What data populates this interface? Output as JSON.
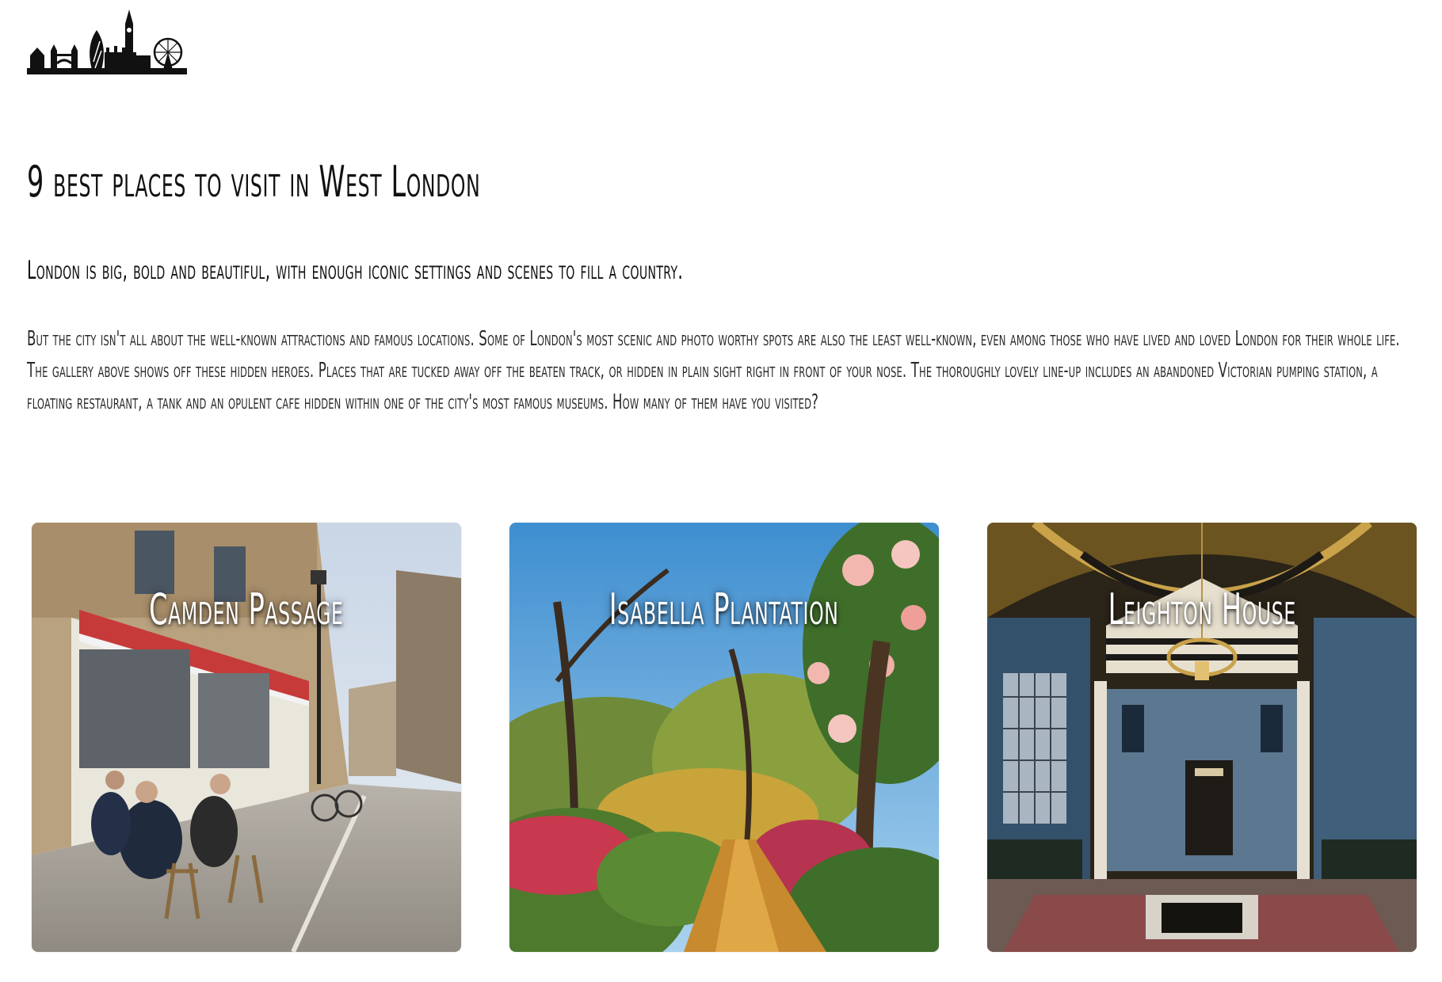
{
  "header": {
    "logo_icon": "london-skyline-icon"
  },
  "article": {
    "title": "9 best places to visit in West London",
    "lede": "London is big, bold and beautiful, with enough iconic settings and scenes to fill a country.",
    "body": "But the city isn't all about the well-known attractions and famous locations. Some of London's most scenic and photo worthy spots are also the least well-known, even among those who have lived and loved London for their whole life. The gallery above shows off these hidden heroes. Places that are tucked away off the beaten track, or hidden in plain sight right in front of your nose. The thoroughly lovely line-up includes an abandoned Victorian pumping station, a floating restaurant, a tank and an opulent cafe hidden within one of the city's most famous museums. How many of them have you visited?"
  },
  "places": [
    {
      "name": "Camden Passage",
      "photo_icon": "street-cafe-photo"
    },
    {
      "name": "Isabella Plantation",
      "photo_icon": "garden-path-photo"
    },
    {
      "name": "Leighton House",
      "photo_icon": "ornate-hall-photo"
    }
  ],
  "colors": {
    "text": "#111111",
    "background": "#ffffff",
    "card_title": "#ffffff"
  }
}
